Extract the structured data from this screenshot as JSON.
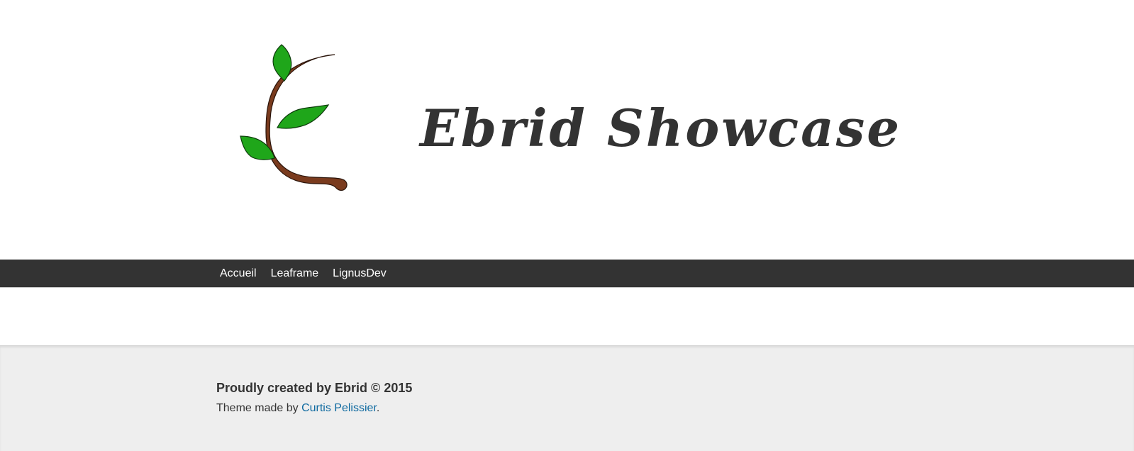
{
  "header": {
    "site_title": "Ebrid Showcase",
    "logo_icon": "branch-with-leaves-icon",
    "colors": {
      "leaf": "#1fa61a",
      "branch": "#7a3b1e",
      "title": "#333333"
    }
  },
  "nav": {
    "background": "#333333",
    "items": [
      {
        "label": "Accueil"
      },
      {
        "label": "Leaframe"
      },
      {
        "label": "LignusDev"
      }
    ]
  },
  "footer": {
    "title": "Proudly created by Ebrid © 2015",
    "credit_prefix": "Theme made by ",
    "credit_link": "Curtis Pelissier",
    "credit_suffix": ".",
    "link_color": "#0f6aa0",
    "background": "#eeeeee"
  }
}
